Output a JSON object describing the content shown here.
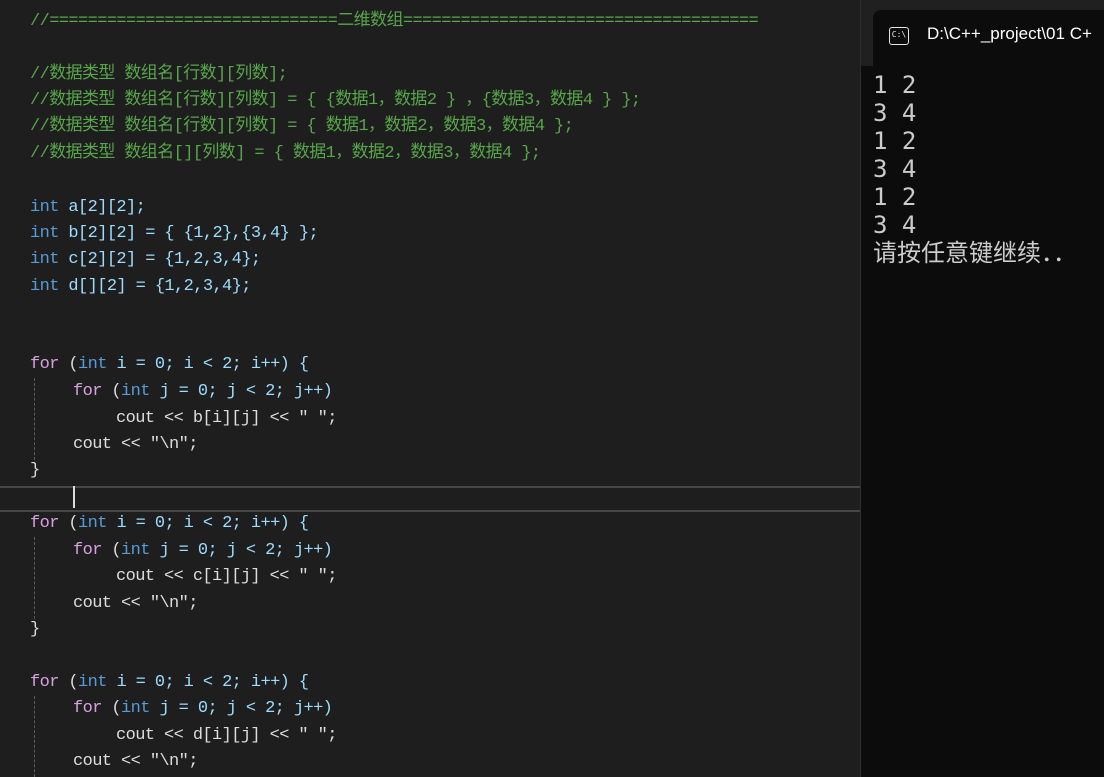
{
  "editor": {
    "lines": {
      "l1": "//==============================二维数组=====================================",
      "l2": "//数据类型 数组名[行数][列数];",
      "l3": "//数据类型 数组名[行数][列数] = { {数据1，数据2 } ，{数据3，数据4 } };",
      "l4": "//数据类型 数组名[行数][列数] = { 数据1，数据2，数据3，数据4 };",
      "l5": "//数据类型 数组名[][列数] = { 数据1，数据2，数据3，数据4 };"
    },
    "kw_int": "int",
    "kw_for": "for",
    "decl_a": " a[2][2];",
    "decl_b": " b[2][2] = { {1,2},{3,4} };",
    "decl_c": " c[2][2] = {1,2,3,4};",
    "decl_d": " d[][2] = {1,2,3,4};",
    "for_outer_open": " (",
    "for_outer_rest": " i = 0; i < 2; i++) {",
    "for_inner_open": " (",
    "for_inner_rest": " j = 0; j < 2; j++)",
    "cout_b": "cout << b[i][j] << \" \";",
    "cout_c": "cout << c[i][j] << \" \";",
    "cout_d": "cout << d[i][j] << \" \";",
    "cout_nl": "cout << \"\\n\";",
    "close_brace": "}"
  },
  "console": {
    "tab_title": "D:\\C++_project\\01 C+",
    "icon": "C:\\",
    "output": [
      "1 2",
      "3 4",
      "1 2",
      "3 4",
      "1 2",
      "3 4",
      "请按任意键继续．．"
    ]
  }
}
